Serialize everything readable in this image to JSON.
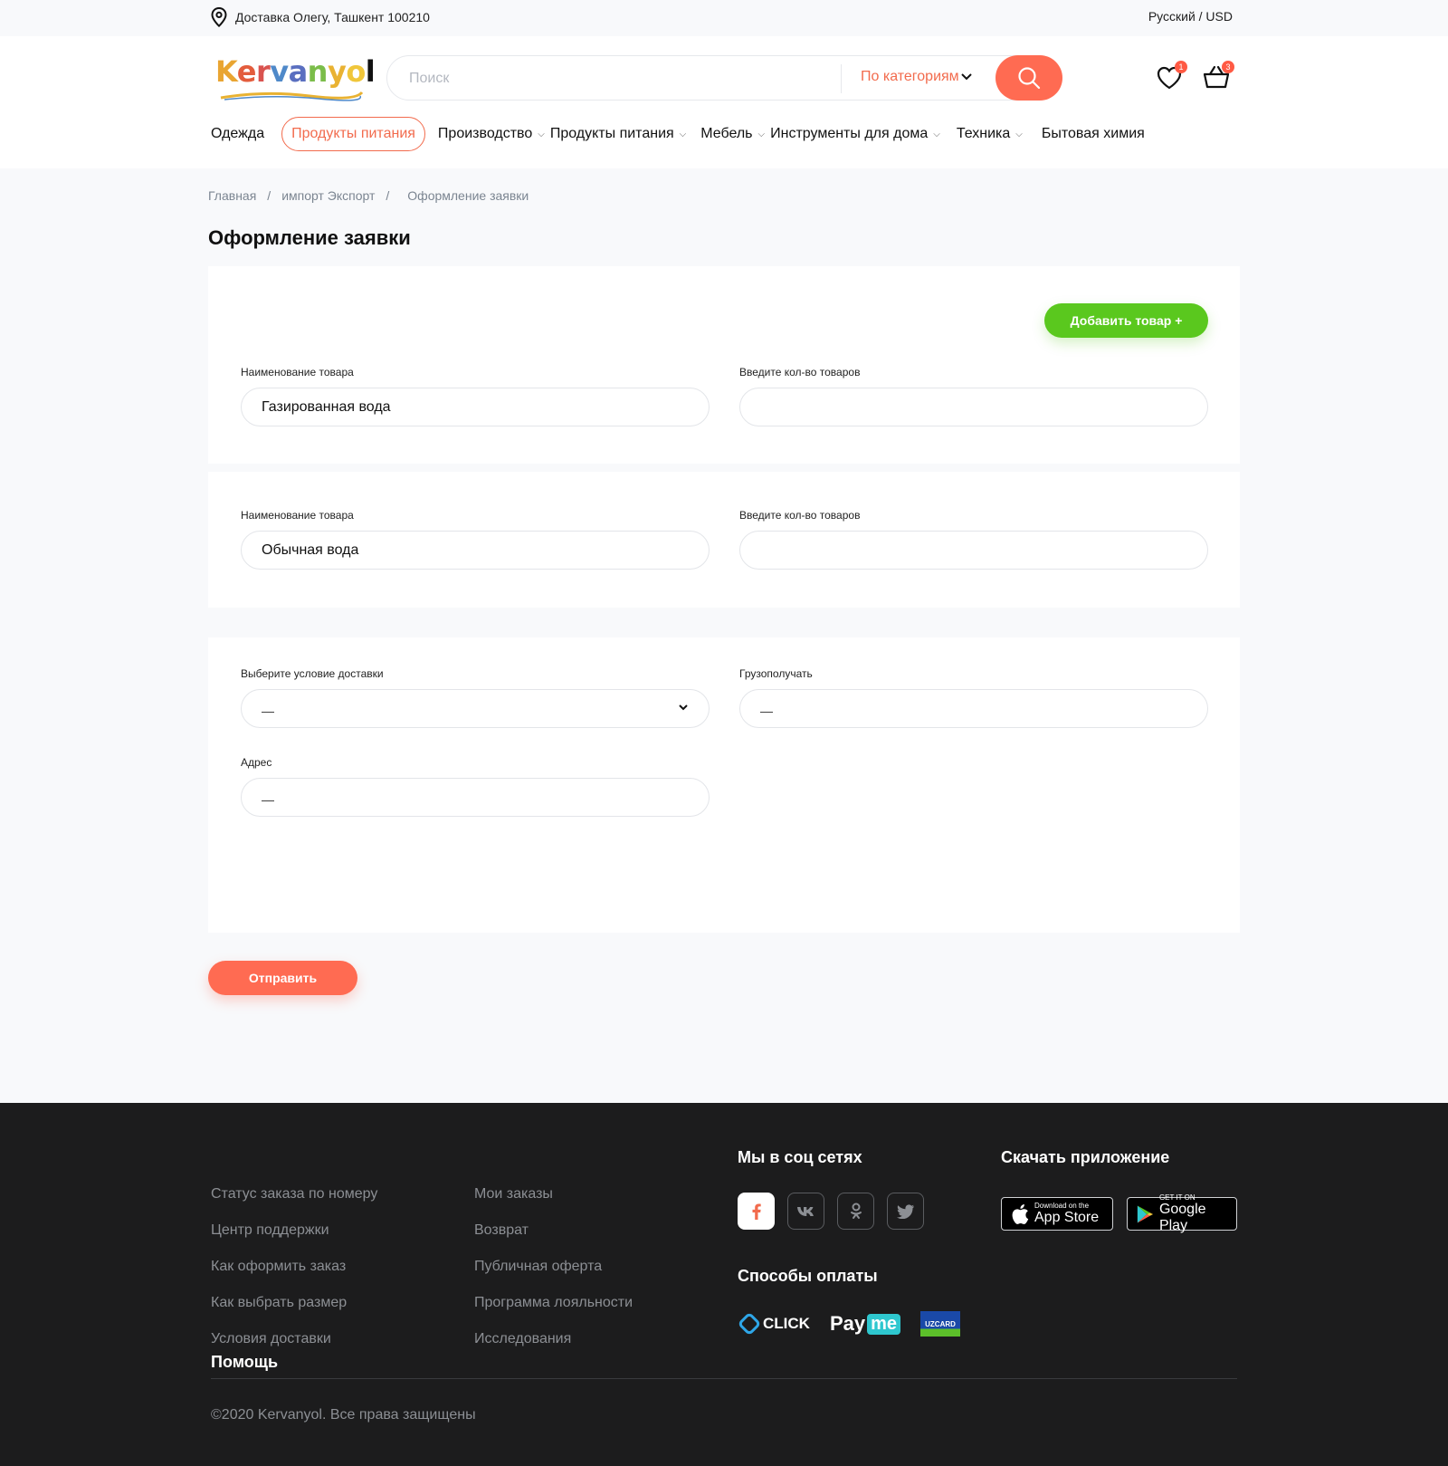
{
  "topbar": {
    "delivery": "Доставка Олегу, Ташкент 100210",
    "lang": "Русский / USD"
  },
  "header": {
    "logo_text": [
      "K",
      "e",
      "r",
      "v",
      "a",
      "n",
      "y",
      "o",
      "l"
    ],
    "search_placeholder": "Поиск",
    "category_label": "По категориям",
    "wishlist_count": "1",
    "cart_count": "3"
  },
  "nav": {
    "items": [
      {
        "label": "Одежда"
      },
      {
        "label": "Продукты питания"
      },
      {
        "label": "Производство"
      },
      {
        "label": "Продукты питания"
      },
      {
        "label": "Мебель"
      },
      {
        "label": "Инструменты для дома"
      },
      {
        "label": "Техника"
      },
      {
        "label": "Бытовая химия"
      }
    ]
  },
  "breadcrumb": {
    "items": [
      "Главная",
      "импорт Экспорт",
      "Оформление заявки"
    ]
  },
  "page": {
    "title": "Оформление заявки",
    "add_button": "Добавить товар +",
    "submit": "Отправить"
  },
  "products": [
    {
      "name_label": "Наименование товара",
      "name_value": "Газированная вода",
      "qty_label": "Введите кол-во товаров",
      "qty_value": ""
    },
    {
      "name_label": "Наименование товара",
      "name_value": "Обычная вода",
      "qty_label": "Введите кол-во товаров",
      "qty_value": ""
    }
  ],
  "delivery": {
    "condition_label": "Выберите условие доставки",
    "condition_value": "—",
    "recipient_label": "Грузополучать",
    "recipient_value": "—",
    "address_label": "Адрес",
    "address_value": "—"
  },
  "footer": {
    "col1": [
      "Статус заказа по номеру",
      "Центр поддержки",
      "Как оформить заказ",
      "Как выбрать размер",
      "Условия доставки"
    ],
    "col2": [
      "Мои заказы",
      "Возврат",
      "Публичная оферта",
      "Программа лояльности",
      "Исследования"
    ],
    "help": "Помощь",
    "social_title": "Мы в соц сетях",
    "payment_title": "Способы оплаты",
    "app_title": "Скачать приложение",
    "payment": {
      "click": "CLICK",
      "payme_pay": "Pay",
      "payme_me": "me",
      "uzcard": "UZCARD"
    },
    "appstore": {
      "small": "Download on the",
      "big": "App Store"
    },
    "googleplay": {
      "small": "GET IT ON",
      "big": "Google Play"
    },
    "copyright": "©2020 Kervanyol. Все права защищены"
  },
  "colors": {
    "accent": "#ff6b52",
    "green": "#5ac81e",
    "footer_bg": "#1c1c1d"
  }
}
